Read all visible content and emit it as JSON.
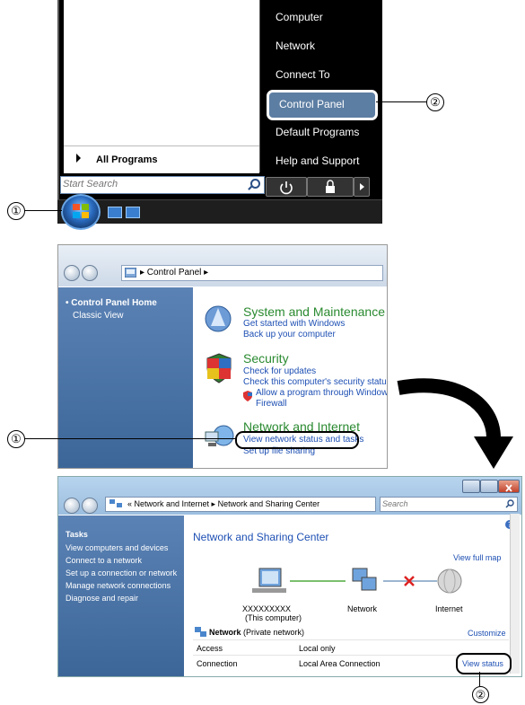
{
  "start_menu": {
    "right_items": [
      "Computer",
      "Network",
      "Connect To",
      "Control Panel",
      "Default Programs",
      "Help and Support"
    ],
    "all_programs": "All Programs",
    "search_placeholder": "Start Search"
  },
  "callouts": {
    "one": "①",
    "two": "②"
  },
  "control_panel": {
    "breadcrumb": "▸ Control Panel ▸",
    "sidebar": {
      "home": "Control Panel Home",
      "classic": "Classic View"
    },
    "categories": [
      {
        "title": "System and Maintenance",
        "links": [
          "Get started with Windows",
          "Back up your computer"
        ]
      },
      {
        "title": "Security",
        "links": [
          "Check for updates",
          "Check this computer's security status",
          "Allow a program through Windows",
          "Firewall"
        ]
      },
      {
        "title": "Network and Internet",
        "links": [
          "View network status and tasks",
          "Set up file sharing"
        ]
      }
    ]
  },
  "network_center": {
    "breadcrumb": "« Network and Internet ▸ Network and Sharing Center",
    "search_placeholder": "Search",
    "tasks_title": "Tasks",
    "tasks": [
      "View computers and devices",
      "Connect to a network",
      "Set up a connection or network",
      "Manage network connections",
      "Diagnose and repair"
    ],
    "heading": "Network and Sharing Center",
    "view_full_map": "View full map",
    "map": {
      "computer": "XXXXXXXXX",
      "computer_sub": "(This computer)",
      "network": "Network",
      "internet": "Internet"
    },
    "network_name": "Network",
    "network_type": "(Private network)",
    "customize": "Customize",
    "rows": [
      {
        "label": "Access",
        "value": "Local only"
      },
      {
        "label": "Connection",
        "value": "Local Area Connection"
      }
    ],
    "view_status": "View status"
  }
}
